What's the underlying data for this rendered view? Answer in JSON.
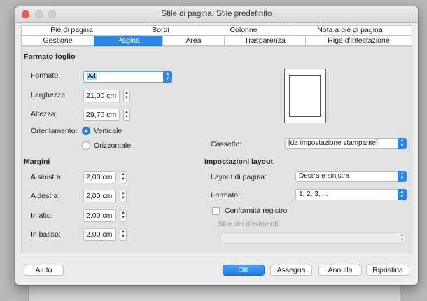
{
  "window": {
    "title": "Stile di pagina: Stile predefinito"
  },
  "tabs": {
    "row1": [
      "Piè di pagina",
      "Bordi",
      "Colonne",
      "Nota a piè di pagina"
    ],
    "row2": [
      "Gestione",
      "Pagina",
      "Area",
      "Trasparenza",
      "Riga d'intestazione"
    ],
    "active": "Pagina"
  },
  "paper": {
    "heading": "Formato foglio",
    "format_label": "Formato:",
    "format_value": "A4",
    "width_label": "Larghezza:",
    "width_value": "21,00 cm",
    "height_label": "Altezza:",
    "height_value": "29,70 cm",
    "orientation_label": "Orientamento:",
    "portrait_label": "Verticale",
    "landscape_label": "Orizzontale",
    "orientation_selected": "Verticale",
    "tray_label": "Cassetto:",
    "tray_value": "[da impostazione stampante]"
  },
  "margins": {
    "heading": "Margini",
    "left_label": "A sinistra:",
    "left_value": "2,00 cm",
    "right_label": "A destra:",
    "right_value": "2,00 cm",
    "top_label": "In alto:",
    "top_value": "2,00 cm",
    "bottom_label": "In basso:",
    "bottom_value": "2,00 cm"
  },
  "layout": {
    "heading": "Impostazioni layout",
    "page_layout_label": "Layout di pagina:",
    "page_layout_value": "Destra e sinistra",
    "format_label": "Formato:",
    "format_value": "1, 2, 3, ...",
    "register_label": "Conformità registro",
    "register_checked": false,
    "reference_style_label": "Stile dei riferimenti:",
    "reference_style_value": ""
  },
  "buttons": {
    "help": "Aiuto",
    "ok": "OK",
    "apply": "Assegna",
    "cancel": "Annulla",
    "reset": "Ripristina"
  },
  "colors": {
    "accent": "#2a87e8",
    "dialog_bg": "#ececec",
    "panel_bg": "#e2e2e2"
  }
}
